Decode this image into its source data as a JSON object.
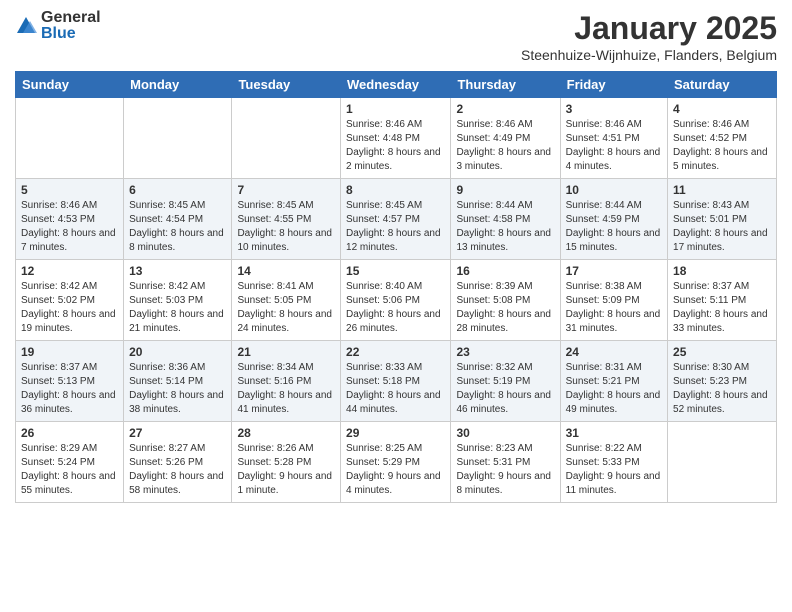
{
  "logo": {
    "general": "General",
    "blue": "Blue"
  },
  "header": {
    "month": "January 2025",
    "location": "Steenhuize-Wijnhuize, Flanders, Belgium"
  },
  "weekdays": [
    "Sunday",
    "Monday",
    "Tuesday",
    "Wednesday",
    "Thursday",
    "Friday",
    "Saturday"
  ],
  "weeks": [
    [
      {
        "day": "",
        "info": ""
      },
      {
        "day": "",
        "info": ""
      },
      {
        "day": "",
        "info": ""
      },
      {
        "day": "1",
        "info": "Sunrise: 8:46 AM\nSunset: 4:48 PM\nDaylight: 8 hours and 2 minutes."
      },
      {
        "day": "2",
        "info": "Sunrise: 8:46 AM\nSunset: 4:49 PM\nDaylight: 8 hours and 3 minutes."
      },
      {
        "day": "3",
        "info": "Sunrise: 8:46 AM\nSunset: 4:51 PM\nDaylight: 8 hours and 4 minutes."
      },
      {
        "day": "4",
        "info": "Sunrise: 8:46 AM\nSunset: 4:52 PM\nDaylight: 8 hours and 5 minutes."
      }
    ],
    [
      {
        "day": "5",
        "info": "Sunrise: 8:46 AM\nSunset: 4:53 PM\nDaylight: 8 hours and 7 minutes."
      },
      {
        "day": "6",
        "info": "Sunrise: 8:45 AM\nSunset: 4:54 PM\nDaylight: 8 hours and 8 minutes."
      },
      {
        "day": "7",
        "info": "Sunrise: 8:45 AM\nSunset: 4:55 PM\nDaylight: 8 hours and 10 minutes."
      },
      {
        "day": "8",
        "info": "Sunrise: 8:45 AM\nSunset: 4:57 PM\nDaylight: 8 hours and 12 minutes."
      },
      {
        "day": "9",
        "info": "Sunrise: 8:44 AM\nSunset: 4:58 PM\nDaylight: 8 hours and 13 minutes."
      },
      {
        "day": "10",
        "info": "Sunrise: 8:44 AM\nSunset: 4:59 PM\nDaylight: 8 hours and 15 minutes."
      },
      {
        "day": "11",
        "info": "Sunrise: 8:43 AM\nSunset: 5:01 PM\nDaylight: 8 hours and 17 minutes."
      }
    ],
    [
      {
        "day": "12",
        "info": "Sunrise: 8:42 AM\nSunset: 5:02 PM\nDaylight: 8 hours and 19 minutes."
      },
      {
        "day": "13",
        "info": "Sunrise: 8:42 AM\nSunset: 5:03 PM\nDaylight: 8 hours and 21 minutes."
      },
      {
        "day": "14",
        "info": "Sunrise: 8:41 AM\nSunset: 5:05 PM\nDaylight: 8 hours and 24 minutes."
      },
      {
        "day": "15",
        "info": "Sunrise: 8:40 AM\nSunset: 5:06 PM\nDaylight: 8 hours and 26 minutes."
      },
      {
        "day": "16",
        "info": "Sunrise: 8:39 AM\nSunset: 5:08 PM\nDaylight: 8 hours and 28 minutes."
      },
      {
        "day": "17",
        "info": "Sunrise: 8:38 AM\nSunset: 5:09 PM\nDaylight: 8 hours and 31 minutes."
      },
      {
        "day": "18",
        "info": "Sunrise: 8:37 AM\nSunset: 5:11 PM\nDaylight: 8 hours and 33 minutes."
      }
    ],
    [
      {
        "day": "19",
        "info": "Sunrise: 8:37 AM\nSunset: 5:13 PM\nDaylight: 8 hours and 36 minutes."
      },
      {
        "day": "20",
        "info": "Sunrise: 8:36 AM\nSunset: 5:14 PM\nDaylight: 8 hours and 38 minutes."
      },
      {
        "day": "21",
        "info": "Sunrise: 8:34 AM\nSunset: 5:16 PM\nDaylight: 8 hours and 41 minutes."
      },
      {
        "day": "22",
        "info": "Sunrise: 8:33 AM\nSunset: 5:18 PM\nDaylight: 8 hours and 44 minutes."
      },
      {
        "day": "23",
        "info": "Sunrise: 8:32 AM\nSunset: 5:19 PM\nDaylight: 8 hours and 46 minutes."
      },
      {
        "day": "24",
        "info": "Sunrise: 8:31 AM\nSunset: 5:21 PM\nDaylight: 8 hours and 49 minutes."
      },
      {
        "day": "25",
        "info": "Sunrise: 8:30 AM\nSunset: 5:23 PM\nDaylight: 8 hours and 52 minutes."
      }
    ],
    [
      {
        "day": "26",
        "info": "Sunrise: 8:29 AM\nSunset: 5:24 PM\nDaylight: 8 hours and 55 minutes."
      },
      {
        "day": "27",
        "info": "Sunrise: 8:27 AM\nSunset: 5:26 PM\nDaylight: 8 hours and 58 minutes."
      },
      {
        "day": "28",
        "info": "Sunrise: 8:26 AM\nSunset: 5:28 PM\nDaylight: 9 hours and 1 minute."
      },
      {
        "day": "29",
        "info": "Sunrise: 8:25 AM\nSunset: 5:29 PM\nDaylight: 9 hours and 4 minutes."
      },
      {
        "day": "30",
        "info": "Sunrise: 8:23 AM\nSunset: 5:31 PM\nDaylight: 9 hours and 8 minutes."
      },
      {
        "day": "31",
        "info": "Sunrise: 8:22 AM\nSunset: 5:33 PM\nDaylight: 9 hours and 11 minutes."
      },
      {
        "day": "",
        "info": ""
      }
    ]
  ]
}
